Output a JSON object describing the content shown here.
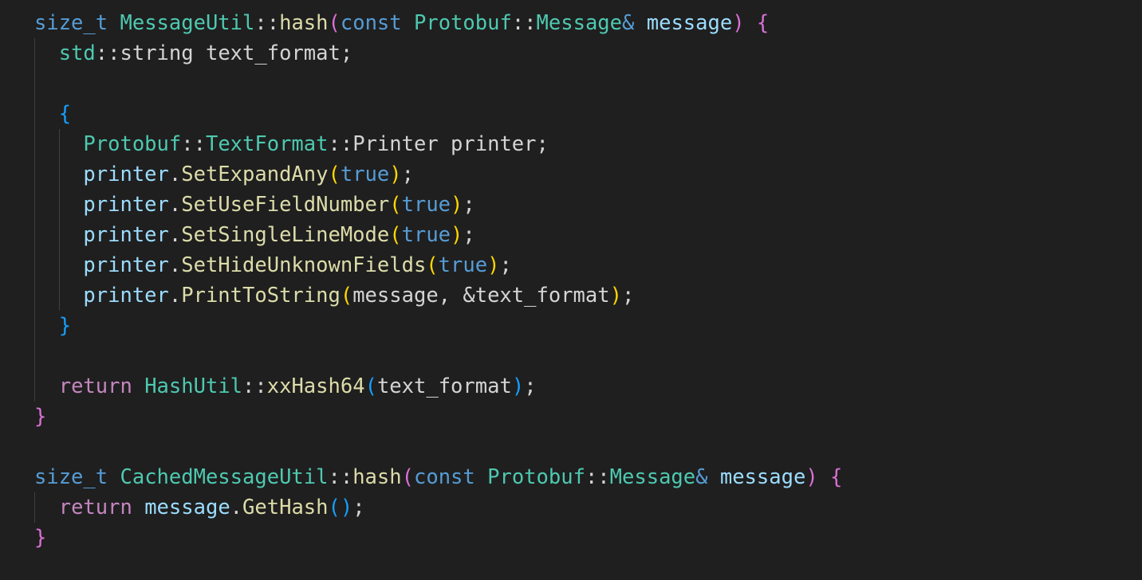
{
  "theme": {
    "background": "#1f1f1f",
    "type": "#4ec9b0",
    "keyword": "#569cd6",
    "control": "#c586c0",
    "function": "#dcdcaa",
    "variable": "#9cdcfe",
    "plain": "#d4d4d4",
    "bracket_gold": "#ffd700",
    "bracket_orchid": "#da70d6",
    "bracket_blue": "#179fff"
  },
  "code_lines": [
    {
      "guides": [],
      "tokens": [
        {
          "text": "size_t",
          "kind": "kw"
        },
        {
          "text": " ",
          "kind": "plain"
        },
        {
          "text": "MessageUtil",
          "kind": "type"
        },
        {
          "text": "::",
          "kind": "op"
        },
        {
          "text": "hash",
          "kind": "fn"
        },
        {
          "text": "(",
          "kind": "b2"
        },
        {
          "text": "const",
          "kind": "kw"
        },
        {
          "text": " ",
          "kind": "plain"
        },
        {
          "text": "Protobuf",
          "kind": "type"
        },
        {
          "text": "::",
          "kind": "op"
        },
        {
          "text": "Message",
          "kind": "type"
        },
        {
          "text": "&",
          "kind": "kw"
        },
        {
          "text": " ",
          "kind": "plain"
        },
        {
          "text": "message",
          "kind": "var"
        },
        {
          "text": ")",
          "kind": "b2"
        },
        {
          "text": " ",
          "kind": "plain"
        },
        {
          "text": "{",
          "kind": "b2"
        }
      ]
    },
    {
      "guides": [
        1
      ],
      "tokens": [
        {
          "text": "  ",
          "kind": "plain"
        },
        {
          "text": "std",
          "kind": "type"
        },
        {
          "text": "::",
          "kind": "op"
        },
        {
          "text": "string",
          "kind": "plain"
        },
        {
          "text": " text_format;",
          "kind": "plain"
        }
      ]
    },
    {
      "guides": [
        1
      ],
      "tokens": []
    },
    {
      "guides": [
        1
      ],
      "tokens": [
        {
          "text": "  ",
          "kind": "plain"
        },
        {
          "text": "{",
          "kind": "b3"
        }
      ]
    },
    {
      "guides": [
        1,
        2
      ],
      "tokens": [
        {
          "text": "    ",
          "kind": "plain"
        },
        {
          "text": "Protobuf",
          "kind": "type"
        },
        {
          "text": "::",
          "kind": "op"
        },
        {
          "text": "TextFormat",
          "kind": "type"
        },
        {
          "text": "::",
          "kind": "op"
        },
        {
          "text": "Printer printer;",
          "kind": "plain"
        }
      ]
    },
    {
      "guides": [
        1,
        2
      ],
      "tokens": [
        {
          "text": "    ",
          "kind": "plain"
        },
        {
          "text": "printer",
          "kind": "var"
        },
        {
          "text": ".",
          "kind": "plain"
        },
        {
          "text": "SetExpandAny",
          "kind": "fn"
        },
        {
          "text": "(",
          "kind": "b1"
        },
        {
          "text": "true",
          "kind": "kw"
        },
        {
          "text": ")",
          "kind": "b1"
        },
        {
          "text": ";",
          "kind": "plain"
        }
      ]
    },
    {
      "guides": [
        1,
        2
      ],
      "tokens": [
        {
          "text": "    ",
          "kind": "plain"
        },
        {
          "text": "printer",
          "kind": "var"
        },
        {
          "text": ".",
          "kind": "plain"
        },
        {
          "text": "SetUseFieldNumber",
          "kind": "fn"
        },
        {
          "text": "(",
          "kind": "b1"
        },
        {
          "text": "true",
          "kind": "kw"
        },
        {
          "text": ")",
          "kind": "b1"
        },
        {
          "text": ";",
          "kind": "plain"
        }
      ]
    },
    {
      "guides": [
        1,
        2
      ],
      "tokens": [
        {
          "text": "    ",
          "kind": "plain"
        },
        {
          "text": "printer",
          "kind": "var"
        },
        {
          "text": ".",
          "kind": "plain"
        },
        {
          "text": "SetSingleLineMode",
          "kind": "fn"
        },
        {
          "text": "(",
          "kind": "b1"
        },
        {
          "text": "true",
          "kind": "kw"
        },
        {
          "text": ")",
          "kind": "b1"
        },
        {
          "text": ";",
          "kind": "plain"
        }
      ]
    },
    {
      "guides": [
        1,
        2
      ],
      "tokens": [
        {
          "text": "    ",
          "kind": "plain"
        },
        {
          "text": "printer",
          "kind": "var"
        },
        {
          "text": ".",
          "kind": "plain"
        },
        {
          "text": "SetHideUnknownFields",
          "kind": "fn"
        },
        {
          "text": "(",
          "kind": "b1"
        },
        {
          "text": "true",
          "kind": "kw"
        },
        {
          "text": ")",
          "kind": "b1"
        },
        {
          "text": ";",
          "kind": "plain"
        }
      ]
    },
    {
      "guides": [
        1,
        2
      ],
      "tokens": [
        {
          "text": "    ",
          "kind": "plain"
        },
        {
          "text": "printer",
          "kind": "var"
        },
        {
          "text": ".",
          "kind": "plain"
        },
        {
          "text": "PrintToString",
          "kind": "fn"
        },
        {
          "text": "(",
          "kind": "b1"
        },
        {
          "text": "message, &text_format",
          "kind": "plain"
        },
        {
          "text": ")",
          "kind": "b1"
        },
        {
          "text": ";",
          "kind": "plain"
        }
      ]
    },
    {
      "guides": [
        1
      ],
      "tokens": [
        {
          "text": "  ",
          "kind": "plain"
        },
        {
          "text": "}",
          "kind": "b3"
        }
      ]
    },
    {
      "guides": [
        1
      ],
      "tokens": []
    },
    {
      "guides": [
        1
      ],
      "tokens": [
        {
          "text": "  ",
          "kind": "plain"
        },
        {
          "text": "return",
          "kind": "ctrl"
        },
        {
          "text": " ",
          "kind": "plain"
        },
        {
          "text": "HashUtil",
          "kind": "type"
        },
        {
          "text": "::",
          "kind": "op"
        },
        {
          "text": "xxHash64",
          "kind": "fn"
        },
        {
          "text": "(",
          "kind": "b3"
        },
        {
          "text": "text_format",
          "kind": "plain"
        },
        {
          "text": ")",
          "kind": "b3"
        },
        {
          "text": ";",
          "kind": "plain"
        }
      ]
    },
    {
      "guides": [],
      "tokens": [
        {
          "text": "}",
          "kind": "b2"
        }
      ]
    },
    {
      "guides": [],
      "tokens": []
    },
    {
      "guides": [],
      "tokens": [
        {
          "text": "size_t",
          "kind": "kw"
        },
        {
          "text": " ",
          "kind": "plain"
        },
        {
          "text": "CachedMessageUtil",
          "kind": "type"
        },
        {
          "text": "::",
          "kind": "op"
        },
        {
          "text": "hash",
          "kind": "fn"
        },
        {
          "text": "(",
          "kind": "b2"
        },
        {
          "text": "const",
          "kind": "kw"
        },
        {
          "text": " ",
          "kind": "plain"
        },
        {
          "text": "Protobuf",
          "kind": "type"
        },
        {
          "text": "::",
          "kind": "op"
        },
        {
          "text": "Message",
          "kind": "type"
        },
        {
          "text": "&",
          "kind": "kw"
        },
        {
          "text": " ",
          "kind": "plain"
        },
        {
          "text": "message",
          "kind": "var"
        },
        {
          "text": ")",
          "kind": "b2"
        },
        {
          "text": " ",
          "kind": "plain"
        },
        {
          "text": "{",
          "kind": "b2"
        }
      ]
    },
    {
      "guides": [
        1
      ],
      "tokens": [
        {
          "text": "  ",
          "kind": "plain"
        },
        {
          "text": "return",
          "kind": "ctrl"
        },
        {
          "text": " ",
          "kind": "plain"
        },
        {
          "text": "message",
          "kind": "var"
        },
        {
          "text": ".",
          "kind": "plain"
        },
        {
          "text": "GetHash",
          "kind": "fn"
        },
        {
          "text": "()",
          "kind": "b3"
        },
        {
          "text": ";",
          "kind": "plain"
        }
      ]
    },
    {
      "guides": [],
      "tokens": [
        {
          "text": "}",
          "kind": "b2"
        }
      ]
    }
  ]
}
